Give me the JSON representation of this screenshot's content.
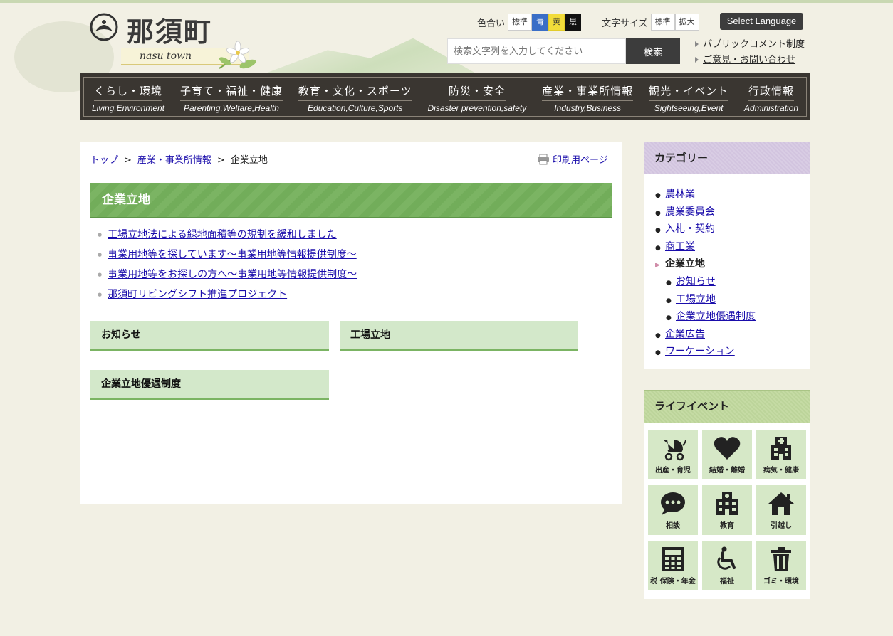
{
  "header": {
    "logo_title": "那須町",
    "logo_sub": "nasu town",
    "color_label": "色合い",
    "color_options": [
      "標準",
      "青",
      "黄",
      "黒"
    ],
    "size_label": "文字サイズ",
    "size_options": [
      "標準",
      "拡大"
    ],
    "language_button": "Select Language",
    "search_placeholder": "検索文字列を入力してください",
    "search_button": "検索",
    "links": [
      "パブリックコメント制度",
      "ご意見・お問い合わせ"
    ]
  },
  "gnav": [
    {
      "jp": "くらし・環境",
      "en": "Living,Environment"
    },
    {
      "jp": "子育て・福祉・健康",
      "en": "Parenting,Welfare,Health"
    },
    {
      "jp": "教育・文化・スポーツ",
      "en": "Education,Culture,Sports"
    },
    {
      "jp": "防災・安全",
      "en": "Disaster prevention,safety"
    },
    {
      "jp": "産業・事業所情報",
      "en": "Industry,Business"
    },
    {
      "jp": "観光・イベント",
      "en": "Sightseeing,Event"
    },
    {
      "jp": "行政情報",
      "en": "Administration"
    }
  ],
  "breadcrumb": {
    "top": "トップ",
    "parent": "産業・事業所情報",
    "current": "企業立地",
    "sep": ">"
  },
  "print_link": "印刷用ページ",
  "page_title": "企業立地",
  "links": [
    "工場立地法による緑地面積等の規制を緩和しました",
    "事業用地等を探しています～事業用地等情報提供制度～",
    "事業用地等をお探しの方へ～事業用地等情報提供制度～",
    "那須町リビングシフト推進プロジェクト"
  ],
  "subcategories": [
    "お知らせ",
    "工場立地",
    "企業立地優遇制度"
  ],
  "sidebar": {
    "category_title": "カテゴリー",
    "categories": [
      {
        "label": "農林業",
        "level": 0
      },
      {
        "label": "農業委員会",
        "level": 0
      },
      {
        "label": "入札・契約",
        "level": 0
      },
      {
        "label": "商工業",
        "level": 0
      },
      {
        "label": "企業立地",
        "level": 0,
        "current": true
      },
      {
        "label": "お知らせ",
        "level": 1
      },
      {
        "label": "工場立地",
        "level": 1
      },
      {
        "label": "企業立地優遇制度",
        "level": 1
      },
      {
        "label": "企業広告",
        "level": 0
      },
      {
        "label": "ワーケーション",
        "level": 0
      }
    ],
    "life_title": "ライフイベント",
    "life_events": [
      {
        "label": "出産・育児",
        "icon": "stroller-icon"
      },
      {
        "label": "結婚・離婚",
        "icon": "heart-icon"
      },
      {
        "label": "病気・健康",
        "icon": "hospital-icon"
      },
      {
        "label": "相談",
        "icon": "chat-bubble-icon"
      },
      {
        "label": "教育",
        "icon": "school-icon"
      },
      {
        "label": "引越し",
        "icon": "house-icon"
      },
      {
        "label": "税 保険・年金",
        "icon": "calculator-icon"
      },
      {
        "label": "福祉",
        "icon": "wheelchair-icon"
      },
      {
        "label": "ゴミ・環境",
        "icon": "trash-icon"
      }
    ]
  }
}
